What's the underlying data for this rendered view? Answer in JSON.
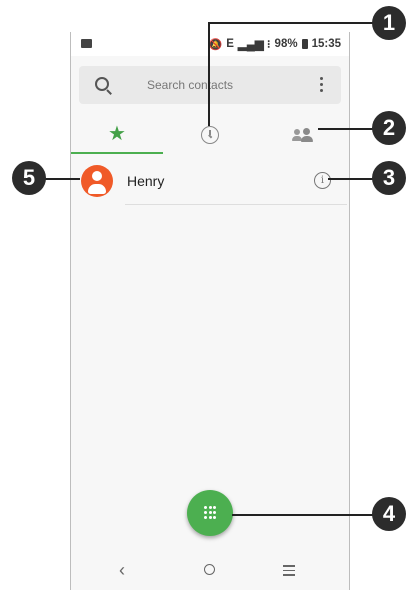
{
  "status_bar": {
    "network": "E",
    "battery": "98%",
    "time": "15:35",
    "icons": [
      "image-icon",
      "mute-icon",
      "signal-icon",
      "battery-icon"
    ]
  },
  "search": {
    "placeholder": "Search contacts",
    "icons": [
      "search-icon",
      "more-vert-icon"
    ]
  },
  "tabs": [
    {
      "name": "favorites",
      "icon": "star-icon",
      "active": true,
      "color": "#43a047"
    },
    {
      "name": "recents",
      "icon": "clock-icon",
      "active": false
    },
    {
      "name": "contacts",
      "icon": "people-icon",
      "active": false
    }
  ],
  "contact": {
    "name": "Henry",
    "avatar_color": "#f05a28",
    "info_glyph": "i"
  },
  "fab": {
    "icon": "dialpad-icon",
    "color": "#4caf50"
  },
  "nav": {
    "back_glyph": "‹"
  },
  "callouts": {
    "c1": "1",
    "c2": "2",
    "c3": "3",
    "c4": "4",
    "c5": "5"
  }
}
